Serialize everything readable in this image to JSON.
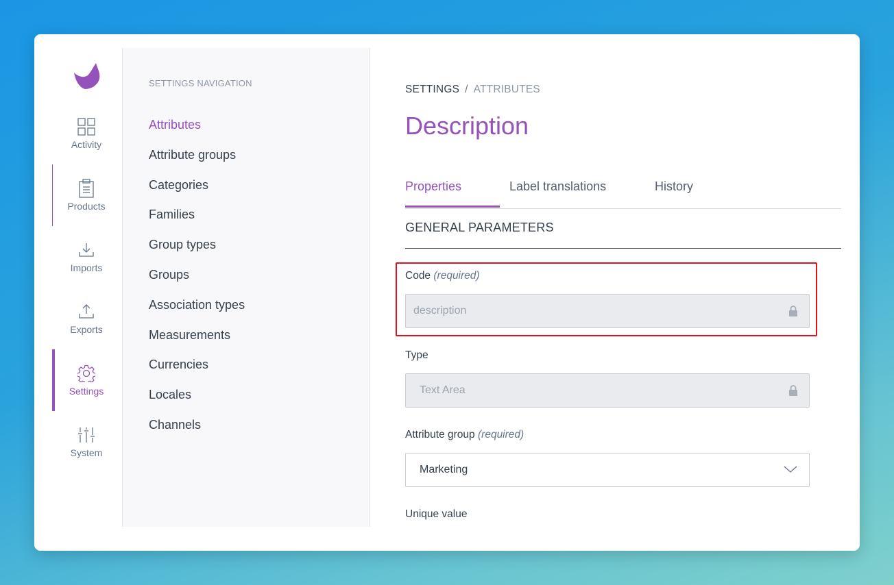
{
  "rail": {
    "items": [
      {
        "label": "Activity",
        "icon": "activity-grid-icon"
      },
      {
        "label": "Products",
        "icon": "products-clipboard-icon"
      },
      {
        "label": "Imports",
        "icon": "imports-download-icon"
      },
      {
        "label": "Exports",
        "icon": "exports-upload-icon"
      },
      {
        "label": "Settings",
        "icon": "settings-gear-icon",
        "active": true
      },
      {
        "label": "System",
        "icon": "system-sliders-icon"
      }
    ]
  },
  "subnav": {
    "title": "SETTINGS NAVIGATION",
    "items": [
      {
        "label": "Attributes",
        "active": true
      },
      {
        "label": "Attribute groups"
      },
      {
        "label": "Categories"
      },
      {
        "label": "Families"
      },
      {
        "label": "Group types"
      },
      {
        "label": "Groups"
      },
      {
        "label": "Association types"
      },
      {
        "label": "Measurements"
      },
      {
        "label": "Currencies"
      },
      {
        "label": "Locales"
      },
      {
        "label": "Channels"
      }
    ]
  },
  "breadcrumb": {
    "first": "SETTINGS",
    "separator": "/",
    "second": "ATTRIBUTES"
  },
  "page": {
    "title": "Description"
  },
  "tabs": [
    {
      "label": "Properties",
      "active": true
    },
    {
      "label": "Label translations"
    },
    {
      "label": "History"
    }
  ],
  "section": {
    "title": "GENERAL PARAMETERS"
  },
  "fields": {
    "code": {
      "label": "Code",
      "hint": "(required)",
      "value": "description",
      "locked": true
    },
    "type": {
      "label": "Type",
      "value": "Text Area",
      "locked": true
    },
    "attribute_group": {
      "label": "Attribute group",
      "hint": "(required)",
      "value": "Marketing"
    },
    "unique_value": {
      "label": "Unique value"
    }
  },
  "colors": {
    "accent": "#9452ba",
    "highlight": "#e0111b",
    "text": "#35404d"
  }
}
